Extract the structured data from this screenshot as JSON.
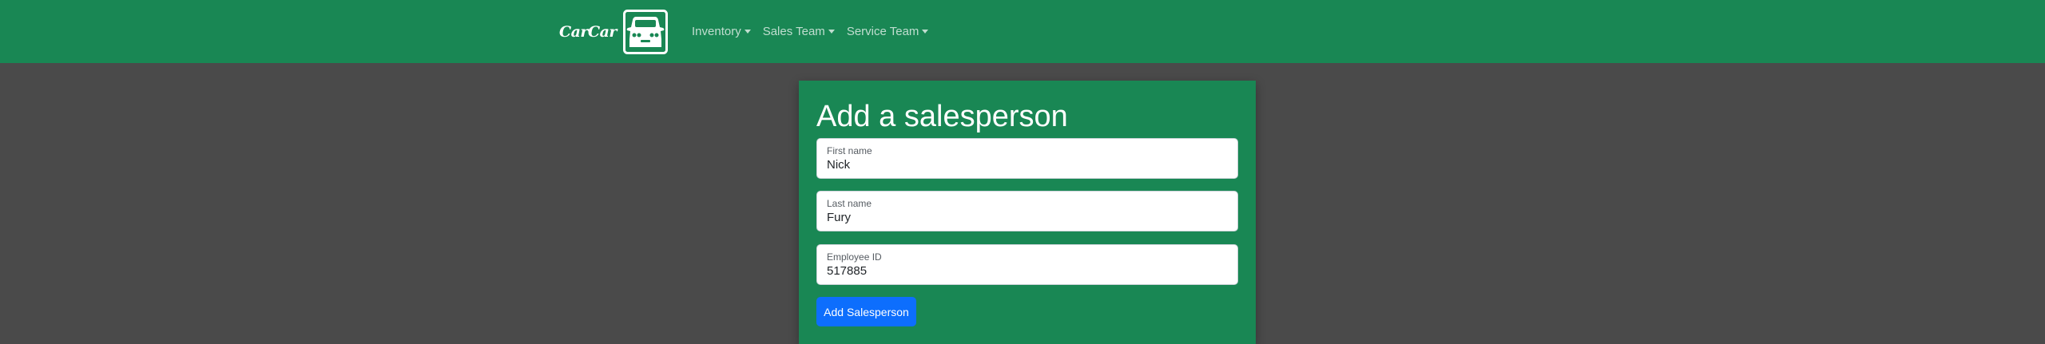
{
  "navbar": {
    "brand_text": "CarCar",
    "logo_icon": "car-icon",
    "items": [
      {
        "label": "Inventory"
      },
      {
        "label": "Sales Team"
      },
      {
        "label": "Service Team"
      }
    ],
    "background": "#198754"
  },
  "form": {
    "title": "Add a salesperson",
    "fields": [
      {
        "label": "First name",
        "value": "Nick"
      },
      {
        "label": "Last name",
        "value": "Fury"
      },
      {
        "label": "Employee ID",
        "value": "517885"
      }
    ],
    "submit_label": "Add Salesperson",
    "submit_color": "#0d6efd"
  }
}
